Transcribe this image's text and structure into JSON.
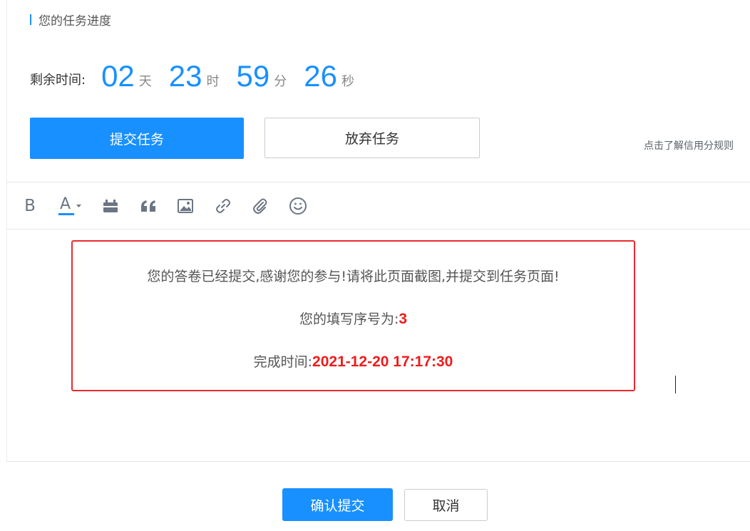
{
  "progress": {
    "title": "您的任务进度",
    "countdown_label": "剩余时间:",
    "days": "02",
    "days_unit": "天",
    "hours": "23",
    "hours_unit": "时",
    "minutes": "59",
    "minutes_unit": "分",
    "seconds": "26",
    "seconds_unit": "秒"
  },
  "actions": {
    "submit_label": "提交任务",
    "abandon_label": "放弃任务",
    "credit_rules_link": "点击了解信用分规则"
  },
  "toolbar": {
    "tools": [
      "bold-icon",
      "font-color-icon",
      "code-block-icon",
      "quote-icon",
      "image-icon",
      "link-icon",
      "attachment-icon",
      "emoji-icon"
    ],
    "bold_glyph": "B",
    "font_color_glyph": "A"
  },
  "notice": {
    "message": "您的答卷已经提交,感谢您的参与!请将此页面截图,并提交到任务页面!",
    "serial_label": "您的填写序号为:",
    "serial_value": "3",
    "time_label": "完成时间:",
    "time_value": "2021-12-20 17:17:30"
  },
  "footer": {
    "confirm_label": "确认提交",
    "cancel_label": "取消"
  },
  "colors": {
    "accent": "#1890ff",
    "alert_border": "#e8292e",
    "alert_text": "#ee1c1c"
  }
}
